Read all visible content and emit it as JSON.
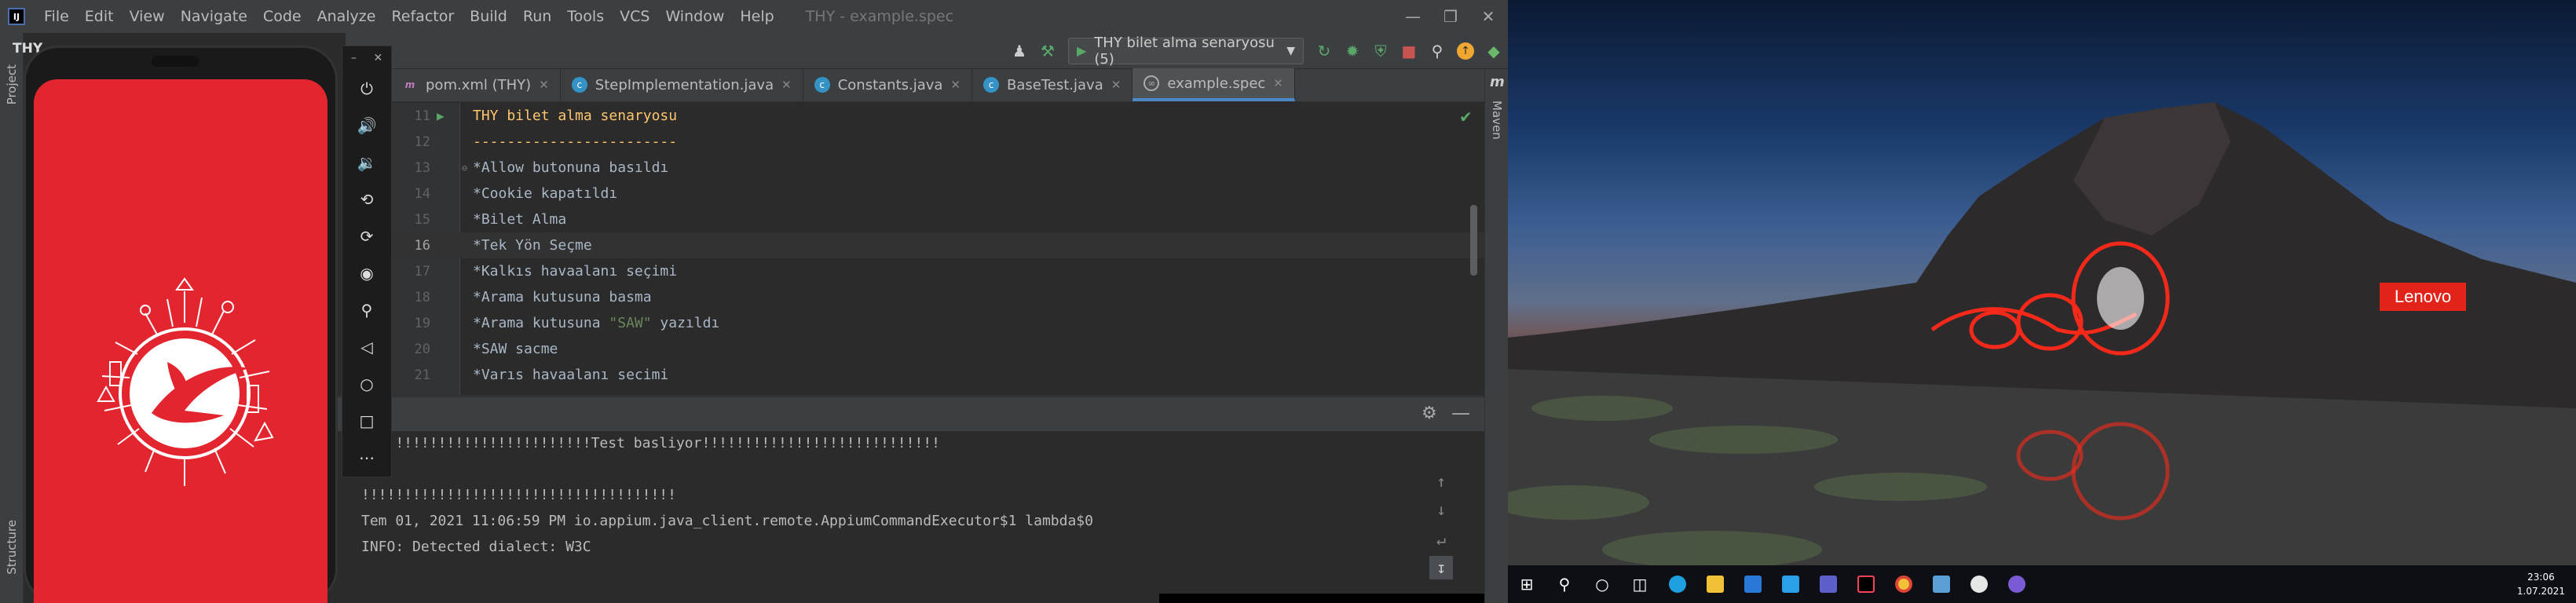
{
  "ide": {
    "logo_text": "IJ",
    "menu": [
      "File",
      "Edit",
      "View",
      "Navigate",
      "Code",
      "Analyze",
      "Refactor",
      "Build",
      "Run",
      "Tools",
      "VCS",
      "Window",
      "Help"
    ],
    "window_title": "THY - example.spec",
    "run_config": "THY bilet alma senaryosu (5)",
    "tabs": [
      {
        "label": "pom.xml (THY)",
        "icon": "maven-icon",
        "color": "#4a88c7"
      },
      {
        "label": "StepImplementation.java",
        "icon": "class-icon",
        "color": "#3592c4"
      },
      {
        "label": "Constants.java",
        "icon": "class-icon",
        "color": "#3592c4"
      },
      {
        "label": "BaseTest.java",
        "icon": "class-icon",
        "color": "#3592c4"
      },
      {
        "label": "example.spec",
        "icon": "spec-icon",
        "color": "#888888"
      }
    ],
    "right_tool": "Maven",
    "left_tools": [
      "Project",
      "Structure"
    ],
    "peek_title": "THY",
    "editor_lines": [
      {
        "num": "11",
        "text": "THY bilet alma senaryosu",
        "kind": "head"
      },
      {
        "num": "12",
        "text": "------------------------",
        "kind": "head"
      },
      {
        "num": "13",
        "text": "*Allow butonuna basıldı",
        "kind": "plain"
      },
      {
        "num": "14",
        "text": "*Cookie kapatıldı",
        "kind": "plain"
      },
      {
        "num": "15",
        "text": "*Bilet Alma",
        "kind": "plain"
      },
      {
        "num": "16",
        "text": "*Tek Yön Seçme",
        "kind": "current"
      },
      {
        "num": "17",
        "text": "*Kalkıs havaalanı seçimi",
        "kind": "plain"
      },
      {
        "num": "18",
        "text": "*Arama kutusuna basma",
        "kind": "plain"
      },
      {
        "num": "19",
        "pre": "*Arama kutusuna ",
        "str": "\"SAW\"",
        "post": " yazıldı",
        "kind": "str"
      },
      {
        "num": "20",
        "text": "*SAW sacme",
        "kind": "plain"
      },
      {
        "num": "21",
        "text": "*Varıs havaalanı secimi",
        "kind": "plain"
      }
    ],
    "console_lines": [
      "!!!!!!!!!!!!!!!!!!!!!!!!!!!Test basliyor!!!!!!!!!!!!!!!!!!!!!!!!!!!!",
      "",
      "!!!!!!!!!!!!!!!!!!!!!!!!!!!!!!!!!!!!!",
      "Tem 01, 2021 11:06:59 PM io.appium.java_client.remote.AppiumCommandExecutor$1 lambda$0",
      "INFO: Detected dialect: W3C"
    ]
  },
  "emulator": {
    "buttons": [
      "power-icon",
      "volume-up-icon",
      "volume-down-icon",
      "rotate-left-icon",
      "rotate-right-icon",
      "camera-icon",
      "zoom-icon",
      "back-icon",
      "home-icon",
      "overview-icon",
      "more-icon"
    ]
  },
  "desktop": {
    "brand": "Lenovo",
    "clock_time": "23:06",
    "clock_date": "1.07.2021"
  }
}
